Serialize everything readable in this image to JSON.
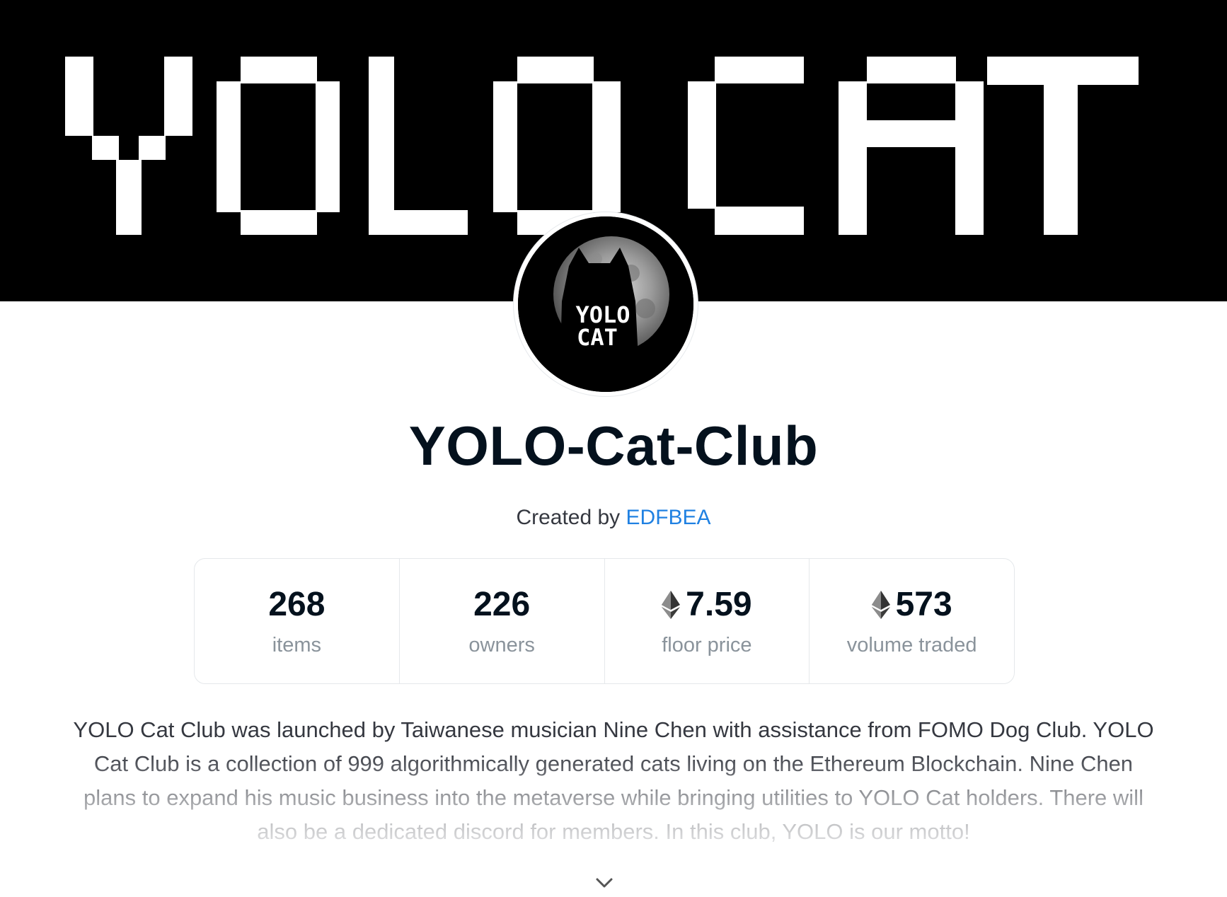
{
  "collection": {
    "banner_text": "YOLO CAT",
    "avatar_text_line1": "YOLO",
    "avatar_text_line2": "CAT",
    "title": "YOLO-Cat-Club",
    "created_by_prefix": "Created by ",
    "creator": "EDFBEA"
  },
  "stats": [
    {
      "value": "268",
      "label": "items",
      "currency_icon": null
    },
    {
      "value": "226",
      "label": "owners",
      "currency_icon": null
    },
    {
      "value": "7.59",
      "label": "floor price",
      "currency_icon": "ethereum-icon"
    },
    {
      "value": "573",
      "label": "volume traded",
      "currency_icon": "ethereum-icon"
    }
  ],
  "description": "YOLO Cat Club was launched by Taiwanese musician Nine Chen with assistance from FOMO Dog Club. YOLO Cat Club is a collection of 999 algorithmically generated cats living on the Ethereum Blockchain. Nine Chen plans to expand his music business into the metaverse while bringing utilities to YOLO Cat holders. There will also be a dedicated discord for members. In this club, YOLO is our motto!",
  "expand_icon": "chevron-down-icon",
  "colors": {
    "link": "#2081e2",
    "title": "#04111d",
    "muted": "#8a939b",
    "border": "#e5e8eb",
    "banner_bg": "#000000"
  }
}
